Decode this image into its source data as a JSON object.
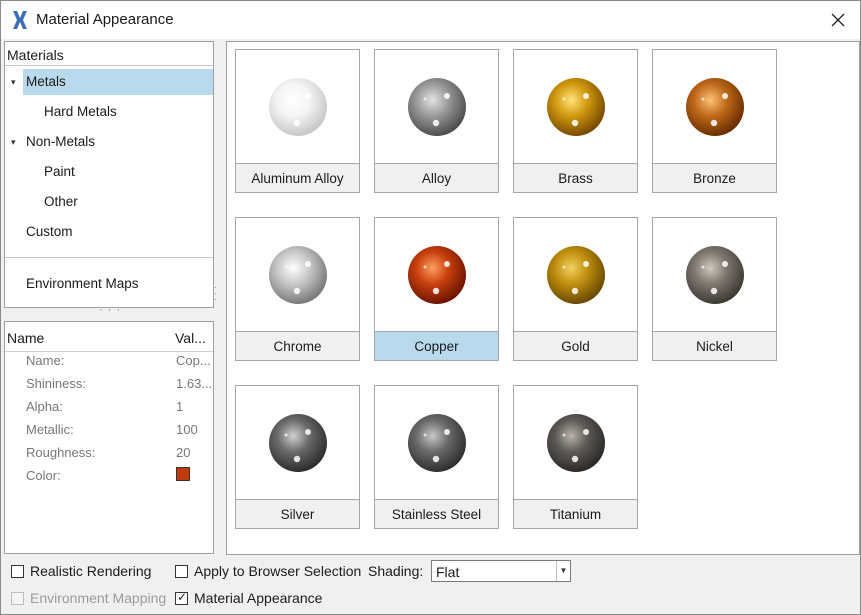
{
  "window": {
    "title": "Material Appearance",
    "app_icon": "hyperworks-logo-icon",
    "close_icon": "close-icon"
  },
  "tree": {
    "header": "Materials",
    "items": [
      {
        "label": "Metals",
        "expanded": true,
        "selected": true
      },
      {
        "label": "Hard Metals"
      },
      {
        "label": "Non-Metals",
        "expanded": true
      },
      {
        "label": "Paint"
      },
      {
        "label": "Other"
      },
      {
        "label": "Custom"
      }
    ],
    "environment": "Environment Maps"
  },
  "properties": {
    "col_name": "Name",
    "col_value": "Val...",
    "rows": [
      {
        "name": "Name:",
        "value": "Cop..."
      },
      {
        "name": "Shininess:",
        "value": "1.63..."
      },
      {
        "name": "Alpha:",
        "value": "1"
      },
      {
        "name": "Metallic:",
        "value": "100"
      },
      {
        "name": "Roughness:",
        "value": "20"
      },
      {
        "name": "Color:",
        "swatch": "#c23b10"
      }
    ]
  },
  "materials": [
    {
      "label": "Aluminum Alloy",
      "base": "#f4f4f4",
      "dark": "#c8c8c8",
      "light": "#ffffff"
    },
    {
      "label": "Alloy",
      "base": "#9a9a9a",
      "dark": "#4e4e4e",
      "light": "#e4e4e4"
    },
    {
      "label": "Brass",
      "base": "#d19a10",
      "dark": "#7a4a00",
      "light": "#ffe27a"
    },
    {
      "label": "Bronze",
      "base": "#c06a1a",
      "dark": "#6a2e00",
      "light": "#ffc27a"
    },
    {
      "label": "Chrome",
      "base": "#c8c8c8",
      "dark": "#7a7a7a",
      "light": "#ffffff"
    },
    {
      "label": "Copper",
      "base": "#c9400e",
      "dark": "#6e1500",
      "light": "#ffa060",
      "selected": true
    },
    {
      "label": "Gold",
      "base": "#c29010",
      "dark": "#6a4a00",
      "light": "#f2d060"
    },
    {
      "label": "Nickel",
      "base": "#7e7870",
      "dark": "#3e3a34",
      "light": "#cfc9c0"
    },
    {
      "label": "Silver",
      "base": "#6a6a6a",
      "dark": "#2e2e2e",
      "light": "#d0d0d0"
    },
    {
      "label": "Stainless Steel",
      "base": "#6a6a6a",
      "dark": "#303030",
      "light": "#c8c8c8"
    },
    {
      "label": "Titanium",
      "base": "#5e5a56",
      "dark": "#2c2a28",
      "light": "#b8b2aa"
    }
  ],
  "bottom": {
    "realistic": {
      "label": "Realistic Rendering",
      "checked": false
    },
    "env_mapping": {
      "label": "Environment Mapping",
      "checked": false,
      "disabled": true
    },
    "apply_browser": {
      "label": "Apply to Browser Selection",
      "checked": false
    },
    "material_appearance": {
      "label": "Material Appearance",
      "checked": true
    },
    "shading_label": "Shading:",
    "shading_value": "Flat"
  }
}
